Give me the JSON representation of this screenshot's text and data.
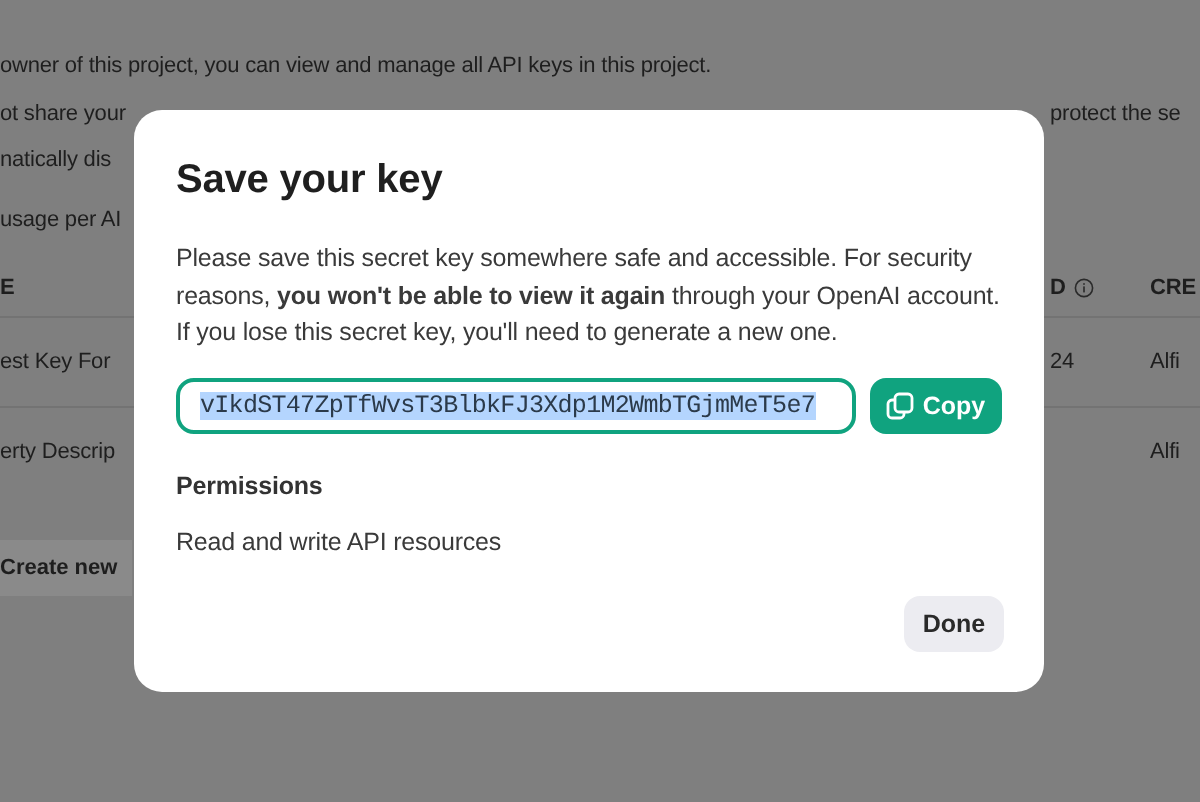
{
  "page": {
    "intro": "owner of this project, you can view and manage all API keys in this project.",
    "warning_left": "ot share your",
    "warning_right": "protect the se",
    "warning_line2": "natically dis",
    "usage": "usage per AI",
    "table": {
      "columns": [
        "E",
        "D",
        "CRE"
      ],
      "rows": [
        {
          "cells": [
            "est Key For",
            "24",
            "Alfi"
          ]
        },
        {
          "cells": [
            "erty Descrip",
            "",
            "Alfi"
          ]
        }
      ]
    },
    "create_button": "Create new"
  },
  "dialog": {
    "title": "Save your key",
    "message": "Please save this secret key somewhere safe and accessible. For security reasons, **you won't be able to view it again** through your OpenAI account. If you lose this secret key, you'll need to generate a new one.",
    "key_value": "vIkdST47ZpTfWvsT3BlbkFJ3Xdp1M2WmbTGjmMeT5e7",
    "key_selected": true,
    "copy_button": "Copy",
    "permissions_heading": "Permissions",
    "permissions": "Read and write API resources",
    "done_button": "Done"
  }
}
